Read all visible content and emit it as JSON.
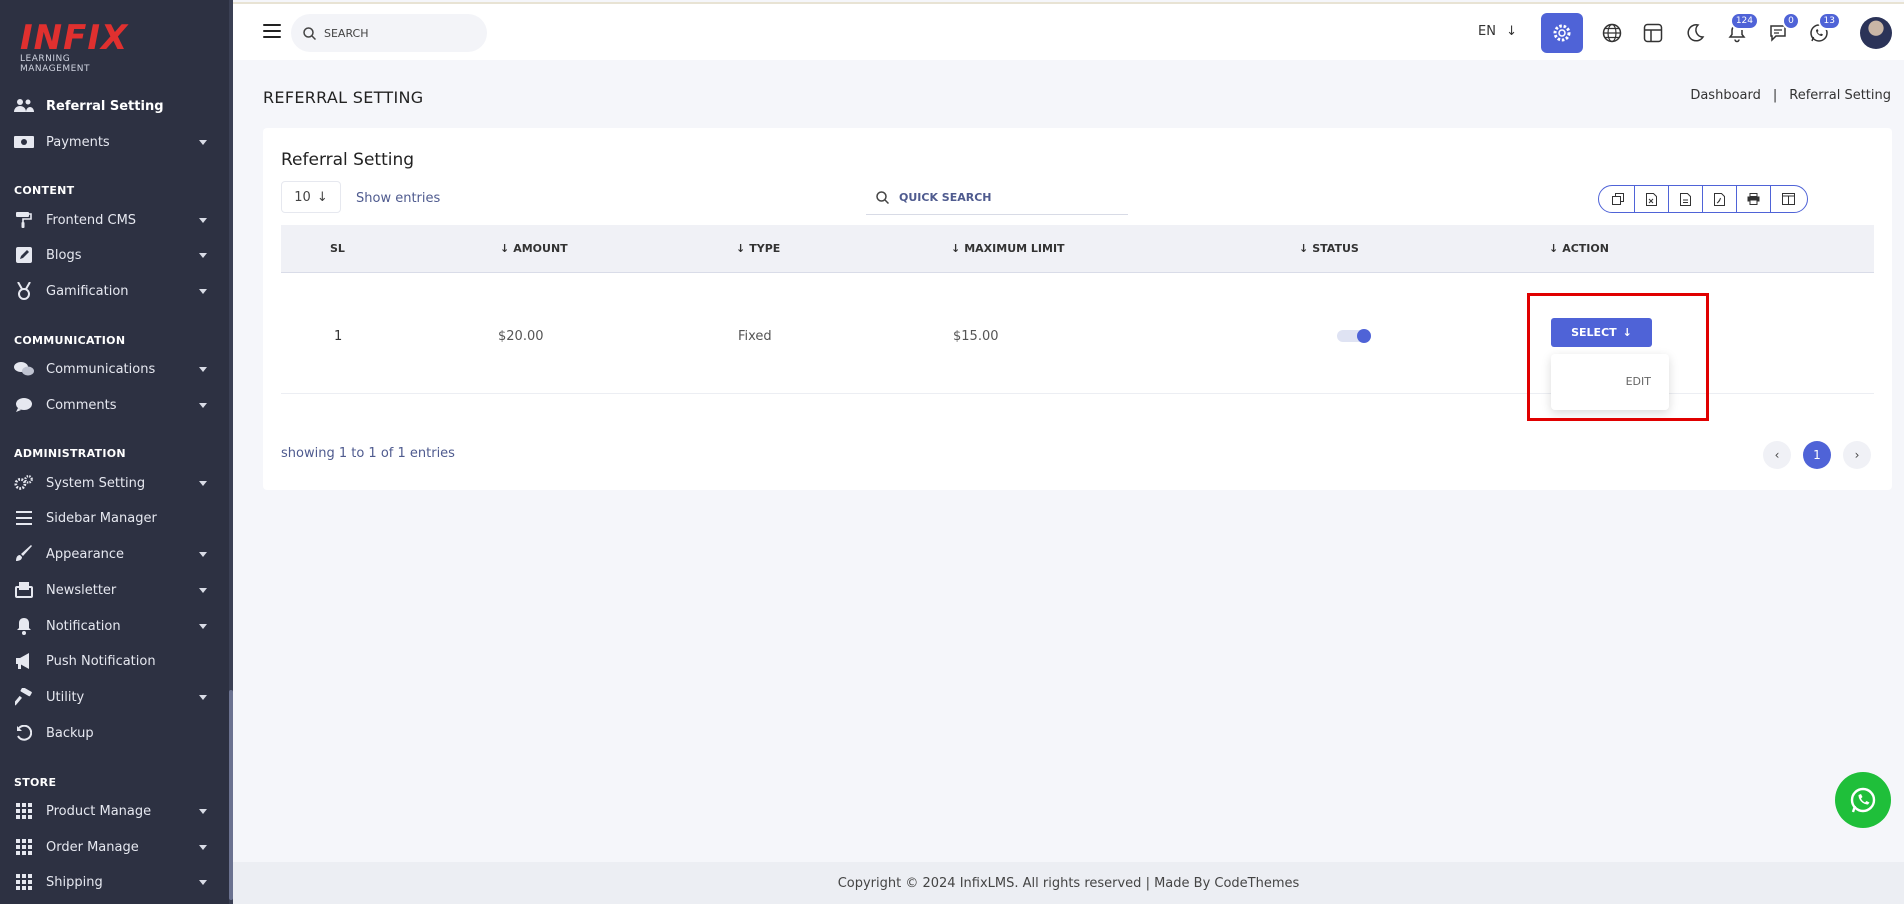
{
  "brand": {
    "logo_text": "INFIX",
    "logo_sub": "LEARNING MANAGEMENT",
    "accent": "#4f63d7",
    "logo_color": "#e0302f"
  },
  "sidebar": {
    "items_top": [
      {
        "label": "Referral Setting",
        "icon": "users-icon",
        "active": true
      },
      {
        "label": "Payments",
        "icon": "money-icon"
      }
    ],
    "sections": {
      "content": "CONTENT",
      "communication": "COMMUNICATION",
      "administration": "ADMINISTRATION",
      "store": "STORE"
    },
    "content_items": [
      {
        "label": "Frontend CMS"
      },
      {
        "label": "Blogs"
      },
      {
        "label": "Gamification"
      }
    ],
    "communication_items": [
      {
        "label": "Communications"
      },
      {
        "label": "Comments"
      }
    ],
    "administration_items": [
      {
        "label": "System Setting"
      },
      {
        "label": "Sidebar Manager"
      },
      {
        "label": "Appearance"
      },
      {
        "label": "Newsletter"
      },
      {
        "label": "Notification"
      },
      {
        "label": "Push Notification"
      },
      {
        "label": "Utility"
      },
      {
        "label": "Backup"
      }
    ],
    "store_items": [
      {
        "label": "Product Manage"
      },
      {
        "label": "Order Manage"
      },
      {
        "label": "Shipping"
      }
    ]
  },
  "topbar": {
    "search_placeholder": "SEARCH",
    "language": "EN",
    "badges": {
      "notifications": "124",
      "messages": "0",
      "chats": "13"
    }
  },
  "page": {
    "title": "REFERRAL SETTING",
    "breadcrumb": [
      "Dashboard",
      "|",
      "Referral Setting"
    ]
  },
  "card": {
    "title": "Referral Setting",
    "entries_value": "10",
    "entries_label": "Show entries",
    "quick_search_placeholder": "QUICK SEARCH",
    "columns": [
      "SL",
      "AMOUNT",
      "TYPE",
      "MAXIMUM LIMIT",
      "STATUS",
      "ACTION"
    ],
    "rows": [
      {
        "sl": "1",
        "amount": "$20.00",
        "type": "Fixed",
        "max_limit": "$15.00",
        "status_on": true
      }
    ],
    "select_label": "SELECT",
    "dropdown_edit": "EDIT",
    "showing": "showing 1 to 1 of 1 entries",
    "current_page": "1"
  },
  "footer": {
    "text": "Copyright © 2024 InfixLMS. All rights reserved | Made By CodeThemes"
  }
}
